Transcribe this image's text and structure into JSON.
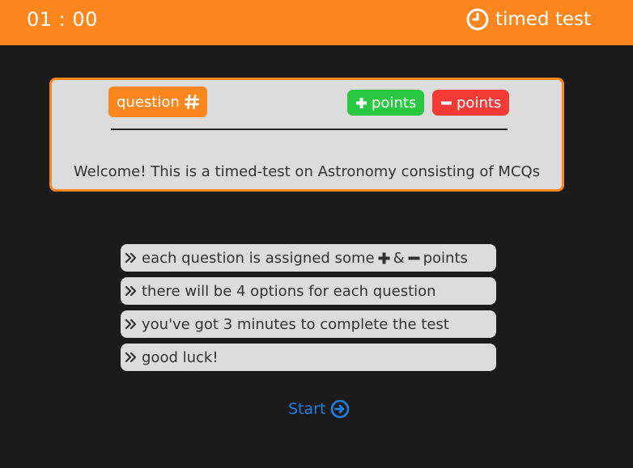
{
  "header": {
    "timer": "01 : 00",
    "title": "timed test",
    "clock_icon": "clock-icon"
  },
  "card": {
    "question_label": "question",
    "hash_icon": "hash-icon",
    "plus_points_label": "points",
    "minus_points_label": "points",
    "welcome_text": "Welcome! This is a timed-test on Astronomy consisting of MCQs"
  },
  "rules": {
    "rule1_before": "each question is assigned some",
    "rule1_and": "&",
    "rule1_after": "points",
    "rule2": "there will be 4 options for each question",
    "rule3": "you've got 3 minutes to complete the test",
    "rule4": "good luck!"
  },
  "start": {
    "label": "Start",
    "icon": "arrow-circle-right-icon"
  },
  "colors": {
    "accent": "#fe861f",
    "plus": "#28c840",
    "minus": "#f23b35",
    "link": "#1e7fe0",
    "background": "#1b1b1b",
    "panel": "#dcdcdc"
  }
}
